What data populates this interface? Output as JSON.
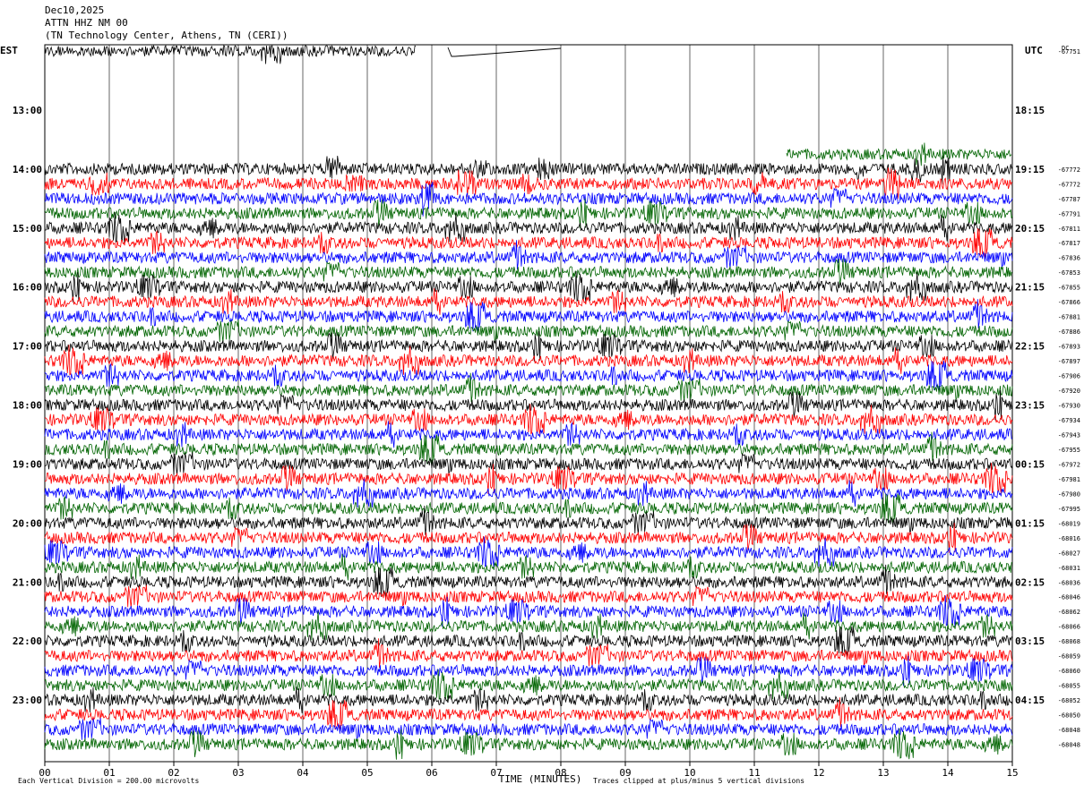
{
  "header": {
    "date": "Dec10,2025",
    "station": "ATTN HHZ NM 00",
    "location": "(TN Technology Center, Athens, TN (CERI))"
  },
  "chart_data": {
    "type": "line",
    "title": "",
    "left_axis_label": "EST",
    "right_axis_label": "UTC",
    "xlabel": "TIME (MINUTES)",
    "xlim": [
      0,
      15
    ],
    "x_ticks": [
      "00",
      "01",
      "02",
      "03",
      "04",
      "05",
      "06",
      "07",
      "08",
      "09",
      "10",
      "11",
      "12",
      "13",
      "14",
      "15"
    ],
    "est_hour_labels": [
      {
        "row": 4.5,
        "label": "13:00"
      },
      {
        "row": 8.5,
        "label": "14:00"
      },
      {
        "row": 12.5,
        "label": "15:00"
      },
      {
        "row": 16.5,
        "label": "16:00"
      },
      {
        "row": 20.5,
        "label": "17:00"
      },
      {
        "row": 24.5,
        "label": "18:00"
      },
      {
        "row": 28.5,
        "label": "19:00"
      },
      {
        "row": 32.5,
        "label": "20:00"
      },
      {
        "row": 36.5,
        "label": "21:00"
      },
      {
        "row": 40.5,
        "label": "22:00"
      },
      {
        "row": 44.5,
        "label": "23:00"
      }
    ],
    "utc_hour_labels": [
      {
        "row": 4.5,
        "label": "18:15"
      },
      {
        "row": 8.5,
        "label": "19:15"
      },
      {
        "row": 12.5,
        "label": "20:15"
      },
      {
        "row": 16.5,
        "label": "21:15"
      },
      {
        "row": 20.5,
        "label": "22:15"
      },
      {
        "row": 24.5,
        "label": "23:15"
      },
      {
        "row": 28.5,
        "label": "00:15"
      },
      {
        "row": 32.5,
        "label": "01:15"
      },
      {
        "row": 36.5,
        "label": "02:15"
      },
      {
        "row": 40.5,
        "label": "03:15"
      },
      {
        "row": 44.5,
        "label": "04:15"
      }
    ],
    "row_dc_offsets": [
      {
        "row": 0,
        "value": "-67751"
      },
      {
        "row": 8,
        "value": "-67772"
      },
      {
        "row": 9,
        "value": "-67772"
      },
      {
        "row": 10,
        "value": "-67787"
      },
      {
        "row": 11,
        "value": "-67791"
      },
      {
        "row": 12,
        "value": "-67811"
      },
      {
        "row": 13,
        "value": "-67817"
      },
      {
        "row": 14,
        "value": "-67836"
      },
      {
        "row": 15,
        "value": "-67853"
      },
      {
        "row": 16,
        "value": "-67855"
      },
      {
        "row": 17,
        "value": "-67866"
      },
      {
        "row": 18,
        "value": "-67881"
      },
      {
        "row": 19,
        "value": "-67886"
      },
      {
        "row": 20,
        "value": "-67893"
      },
      {
        "row": 21,
        "value": "-67897"
      },
      {
        "row": 22,
        "value": "-67906"
      },
      {
        "row": 23,
        "value": "-67920"
      },
      {
        "row": 24,
        "value": "-67930"
      },
      {
        "row": 25,
        "value": "-67934"
      },
      {
        "row": 26,
        "value": "-67943"
      },
      {
        "row": 27,
        "value": "-67955"
      },
      {
        "row": 28,
        "value": "-67972"
      },
      {
        "row": 29,
        "value": "-67981"
      },
      {
        "row": 30,
        "value": "-67980"
      },
      {
        "row": 31,
        "value": "-67995"
      },
      {
        "row": 32,
        "value": "-68019"
      },
      {
        "row": 33,
        "value": "-68016"
      },
      {
        "row": 34,
        "value": "-68027"
      },
      {
        "row": 35,
        "value": "-68031"
      },
      {
        "row": 36,
        "value": "-68036"
      },
      {
        "row": 37,
        "value": "-68046"
      },
      {
        "row": 38,
        "value": "-68062"
      },
      {
        "row": 39,
        "value": "-68066"
      },
      {
        "row": 40,
        "value": "-68068"
      },
      {
        "row": 41,
        "value": "-68059"
      },
      {
        "row": 42,
        "value": "-68060"
      },
      {
        "row": 43,
        "value": "-68055"
      },
      {
        "row": 44,
        "value": "-68052"
      },
      {
        "row": 45,
        "value": "-68050"
      },
      {
        "row": 46,
        "value": "-68048"
      },
      {
        "row": 47,
        "value": "-68048"
      }
    ],
    "dc_header": "DC",
    "row_count": 48,
    "series_colors": [
      "#000000",
      "#ff0000",
      "#0000ff",
      "#006400"
    ],
    "partial_rows": [
      {
        "row": 0,
        "xrange": [
          0,
          5.75
        ],
        "color": "#000000"
      },
      {
        "row": 7,
        "xrange": [
          11.5,
          15
        ],
        "color": "#006400"
      }
    ],
    "gap_segment": {
      "row": 0,
      "xrange": [
        6.25,
        8.0
      ]
    },
    "grid": true,
    "footer_left": "Each Vertical Division =  200.00 microvolts",
    "footer_right": "Traces clipped at plus/minus 5 vertical divisions"
  }
}
